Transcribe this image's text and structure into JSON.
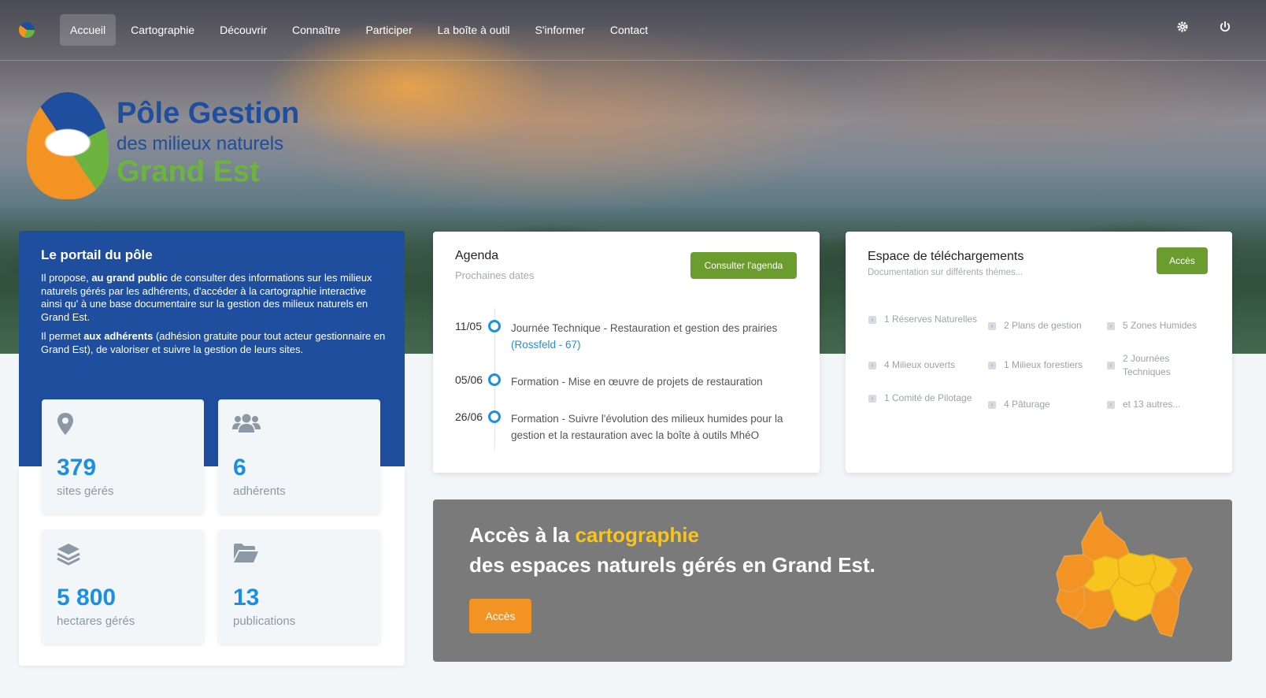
{
  "nav": {
    "items": [
      {
        "label": "Accueil",
        "active": true
      },
      {
        "label": "Cartographie"
      },
      {
        "label": "Découvrir"
      },
      {
        "label": "Connaître"
      },
      {
        "label": "Participer"
      },
      {
        "label": "La boîte à outil"
      },
      {
        "label": "S'informer"
      },
      {
        "label": "Contact"
      }
    ],
    "right_icons": [
      "gear-icon",
      "power-icon"
    ]
  },
  "brand": {
    "line1": "Pôle Gestion",
    "line2": "des milieux naturels",
    "line3": "Grand Est"
  },
  "portal": {
    "title": "Le portail du pôle",
    "p1_before": "Il propose, ",
    "p1_bold": "au grand public",
    "p1_after": " de consulter des informations sur les milieux naturels gérés par les adhérents, d'accéder à la cartographie interactive ainsi qu' à une base documentaire sur la gestion des milieux naturels en Grand Est.",
    "p2_before": "Il permet ",
    "p2_bold": "aux adhérents",
    "p2_after": " (adhésion gratuite pour tout acteur gestionnaire en Grand Est), de valoriser et suivre la gestion de leurs sites.",
    "stats": [
      {
        "icon": "map-marker-icon",
        "value": "379",
        "label": "sites gérés"
      },
      {
        "icon": "users-icon",
        "value": "6",
        "label": "adhérents"
      },
      {
        "icon": "layers-icon",
        "value": "5 800",
        "label": "hectares gérés"
      },
      {
        "icon": "folder-open-icon",
        "value": "13",
        "label": "publications"
      }
    ]
  },
  "agenda": {
    "title": "Agenda",
    "subtitle": "Prochaines dates",
    "button": "Consulter l'agenda",
    "events": [
      {
        "date": "11/05",
        "text": "Journée Technique - Restauration et gestion des prairies",
        "location": "(Rossfeld - 67)"
      },
      {
        "date": "05/06",
        "text": "Formation - Mise en œuvre de projets de restauration",
        "location": ""
      },
      {
        "date": "26/06",
        "text": "Formation - Suivre l'évolution des milieux humides pour la gestion et la restauration avec la boîte à outils MhéO",
        "location": ""
      }
    ]
  },
  "downloads": {
    "title": "Espace de téléchargements",
    "subtitle": "Documentation sur différents thèmes...",
    "button": "Accès",
    "items": [
      "1 Réserves Naturelles",
      "2 Plans de gestion",
      "5 Zones Humides",
      "4 Milieux ouverts",
      "1 Milieux forestiers",
      "2 Journées Techniques",
      "1 Comité de Pilotage",
      "4 Pâturage",
      "et 13 autres..."
    ]
  },
  "map_banner": {
    "line1_before": "Accès à la ",
    "line1_highlight": "cartographie",
    "line2": "des espaces naturels gérés en Grand Est.",
    "button": "Accès",
    "colors": {
      "highlight": "#f7c51e",
      "button": "#f39323",
      "map_orange": "#f39323",
      "map_yellow": "#f7c51e"
    }
  },
  "colors": {
    "primary_blue": "#1f4e9e",
    "green": "#6a9c2e",
    "accent_blue": "#1b8fe3",
    "grey_banner": "#7a7a7a"
  }
}
